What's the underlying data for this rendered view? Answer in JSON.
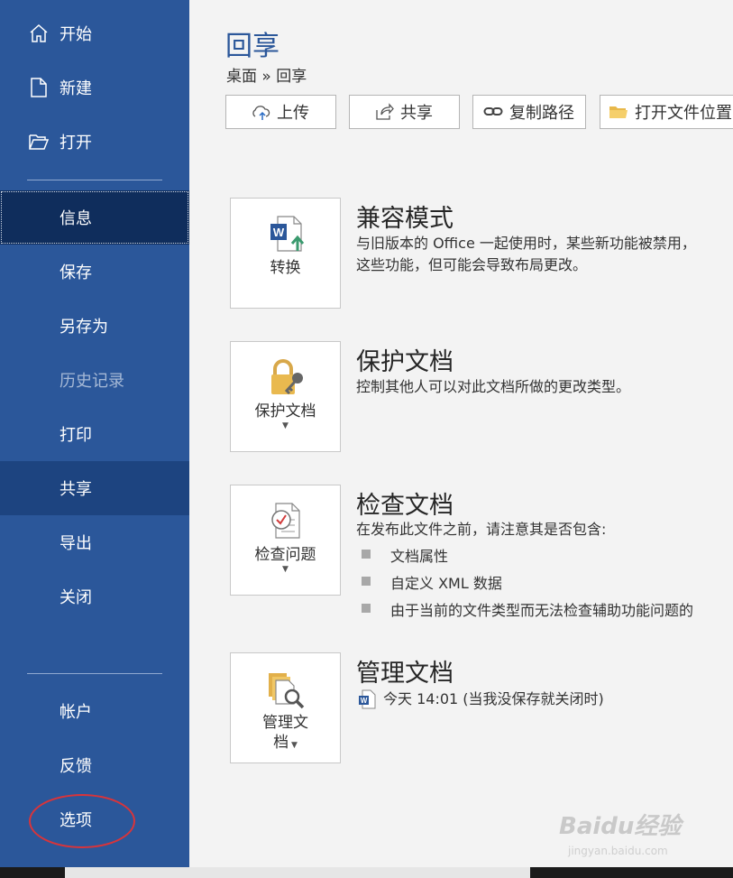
{
  "sidebar": {
    "top_items": [
      {
        "label": "开始",
        "icon": "home-icon"
      },
      {
        "label": "新建",
        "icon": "new-document-icon"
      },
      {
        "label": "打开",
        "icon": "open-folder-icon"
      }
    ],
    "items": [
      {
        "label": "信息",
        "state": "selected"
      },
      {
        "label": "保存"
      },
      {
        "label": "另存为"
      },
      {
        "label": "历史记录",
        "state": "disabled"
      },
      {
        "label": "打印"
      },
      {
        "label": "共享",
        "state": "hovered"
      },
      {
        "label": "导出"
      },
      {
        "label": "关闭"
      }
    ],
    "bottom_items": [
      {
        "label": "帐户"
      },
      {
        "label": "反馈"
      },
      {
        "label": "选项",
        "annotated": true
      }
    ],
    "annotation_color": "#d9343a"
  },
  "header": {
    "title": "回享",
    "breadcrumb": "桌面 » 回享"
  },
  "toolbar": {
    "upload": "上传",
    "share": "共享",
    "copy_path": "复制路径",
    "open_location": "打开文件位置"
  },
  "sections": {
    "compat": {
      "button_label": "转换",
      "title": "兼容模式",
      "text_line1": "与旧版本的 Office 一起使用时，某些新功能被禁用，",
      "text_line2": "这些功能，但可能会导致布局更改。"
    },
    "protect": {
      "button_label": "保护文档",
      "title": "保护文档",
      "text": "控制其他人可以对此文档所做的更改类型。"
    },
    "inspect": {
      "button_label": "检查问题",
      "title": "检查文档",
      "text": "在发布此文件之前，请注意其是否包含:",
      "bullets": [
        "文档属性",
        "自定义 XML 数据",
        "由于当前的文件类型而无法检查辅助功能问题的"
      ]
    },
    "manage": {
      "button_label_1": "管理文",
      "button_label_2": "档",
      "title": "管理文档",
      "version": "今天 14:01 (当我没保存就关闭时)"
    }
  },
  "watermark": {
    "text": "Baidu经验",
    "sub": "jingyan.baidu.com"
  },
  "colors": {
    "sidebar": "#2b579a",
    "selected": "#0f2d5c",
    "hover": "#1d4480",
    "accent": "#2b579a"
  }
}
